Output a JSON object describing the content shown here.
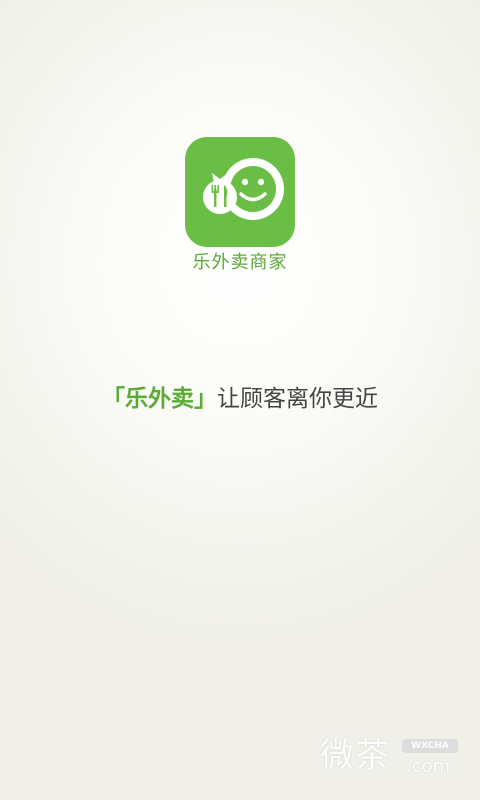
{
  "app": {
    "name": "乐外卖商家",
    "logo_icon": "smiley-face-with-fork-and-knife-icon",
    "brand_color": "#6abd45"
  },
  "slogan": {
    "bracket_open": "「",
    "brand": "乐外卖",
    "bracket_close": "」",
    "text": "让顾客离你更近"
  },
  "watermark": {
    "text": "微茶",
    "badge": "WXCHA",
    "domain": ".com"
  }
}
